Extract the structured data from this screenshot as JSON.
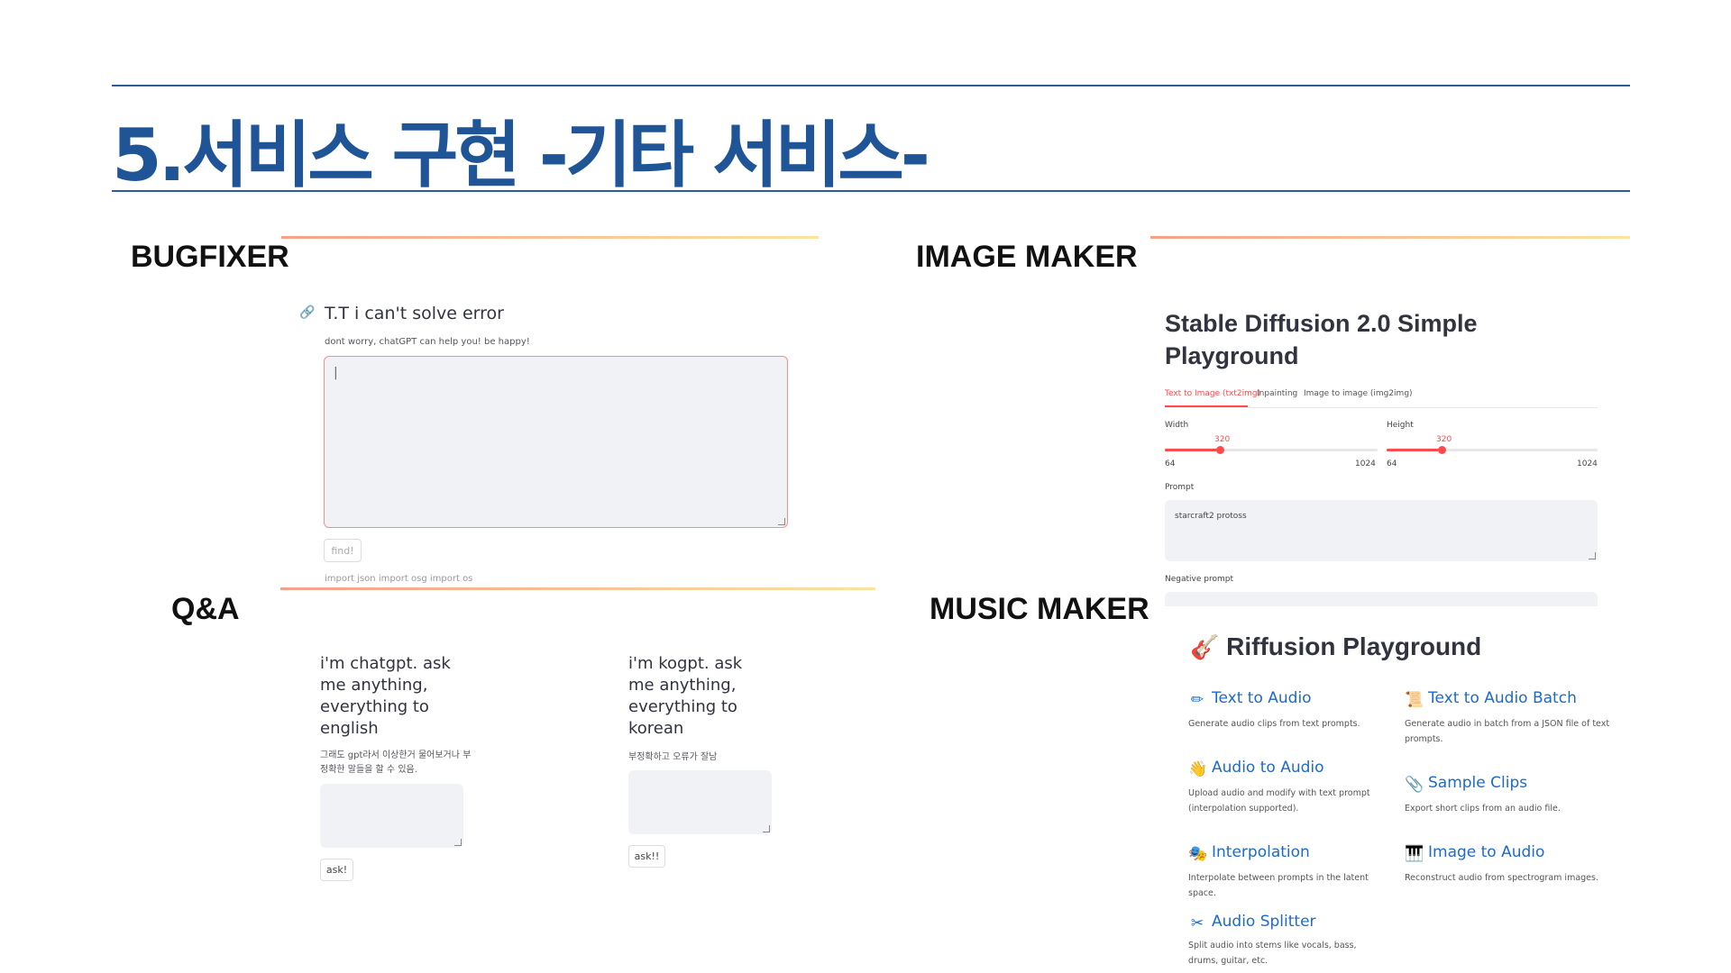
{
  "page": {
    "title": "5.서비스 구현 -기타 서비스-"
  },
  "sections": {
    "bugfixer": "BUGFIXER",
    "image_maker": "IMAGE MAKER",
    "qa": "Q&A",
    "music_maker": "MUSIC MAKER"
  },
  "bugfixer": {
    "link_icon": "link-icon",
    "heading": "T.T i can't solve error",
    "subtext": "dont worry, chatGPT can help you! be happy!",
    "textarea_value": "|",
    "button_label": "find!",
    "caption": "import json import osg import os"
  },
  "image_maker": {
    "title": "Stable Diffusion 2.0 Simple Playground",
    "tabs": [
      "Text to Image (txt2img)",
      "Inpainting",
      "Image to image (img2img)"
    ],
    "active_tab": 0,
    "width": {
      "label": "Width",
      "value": "320",
      "min": "64",
      "max": "1024",
      "fraction": 0.26
    },
    "height": {
      "label": "Height",
      "value": "320",
      "min": "64",
      "max": "1024",
      "fraction": 0.26
    },
    "prompt_label": "Prompt",
    "prompt_value": "starcraft2 protoss",
    "negative_prompt_label": "Negative prompt",
    "accent_color": "#ff4b4b"
  },
  "qa": {
    "chatgpt": {
      "heading": "i'm chatgpt. ask me anything, everything to english",
      "note": "그래도 gpt라서 이상한거 물어보거나 부정확한 말들을 할 수 있음.",
      "button_label": "ask!"
    },
    "kogpt": {
      "heading": "i'm kogpt. ask me anything, everything to korean",
      "note": "부정확하고 오류가 잘남",
      "button_label": "ask!!"
    }
  },
  "music_maker": {
    "title": "Riffusion Playground",
    "title_icon": "guitar-icon",
    "items": [
      {
        "icon": "pencil-icon",
        "glyph": "✏",
        "label": "Text to Audio",
        "desc": "Generate audio clips from text prompts."
      },
      {
        "icon": "scroll-icon",
        "glyph": "📜",
        "label": "Text to Audio Batch",
        "desc": "Generate audio in batch from a JSON file of text prompts."
      },
      {
        "icon": "hand-icon",
        "glyph": "👋",
        "label": "Audio to Audio",
        "desc": "Upload audio and modify with text prompt (interpolation supported)."
      },
      {
        "icon": "clip-icon",
        "glyph": "📎",
        "label": "Sample Clips",
        "desc": "Export short clips from an audio file."
      },
      {
        "icon": "masks-icon",
        "glyph": "🎭",
        "label": "Interpolation",
        "desc": "Interpolate between prompts in the latent space."
      },
      {
        "icon": "piano-icon",
        "glyph": "🎹",
        "label": "Image to Audio",
        "desc": "Reconstruct audio from spectrogram images."
      },
      {
        "icon": "scissors-icon",
        "glyph": "✂",
        "label": "Audio Splitter",
        "desc": "Split audio into stems like vocals, bass, drums, guitar, etc."
      }
    ]
  }
}
